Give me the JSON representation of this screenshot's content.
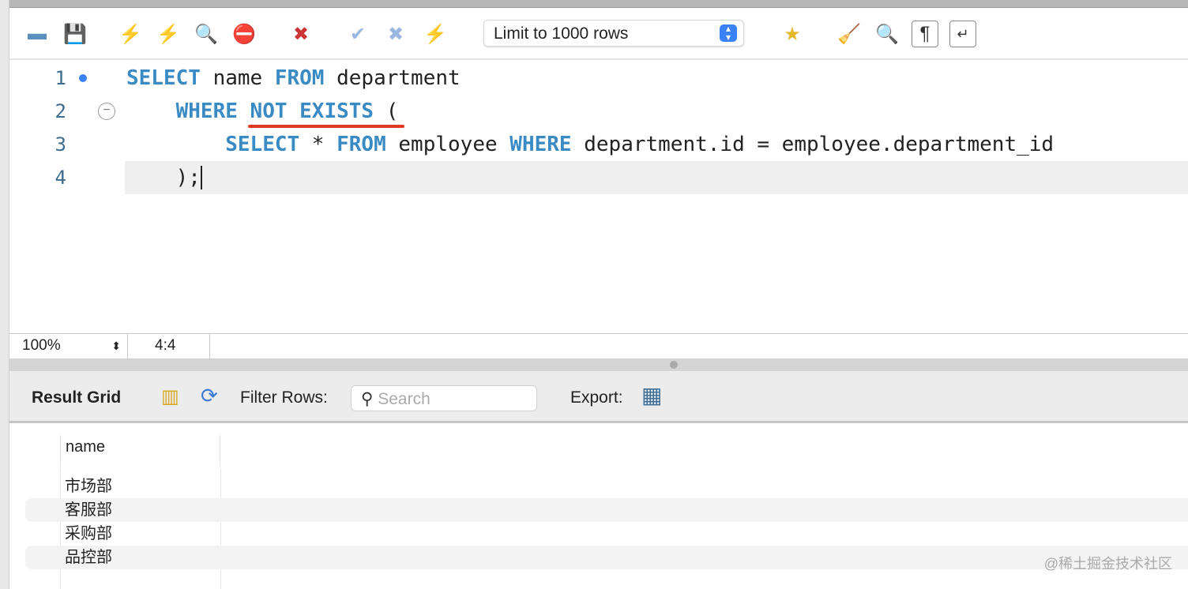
{
  "toolbar": {
    "limit_select": "Limit to 1000 rows"
  },
  "editor": {
    "lines": [
      {
        "num": "1",
        "parts": [
          {
            "t": "SELECT",
            "k": 1
          },
          {
            "t": " name ",
            "k": 0
          },
          {
            "t": "FROM",
            "k": 1
          },
          {
            "t": " department",
            "k": 0
          }
        ]
      },
      {
        "num": "2",
        "parts": [
          {
            "t": "    ",
            "k": 0
          },
          {
            "t": "WHERE NOT EXISTS",
            "k": 1
          },
          {
            "t": " (",
            "k": 0
          }
        ]
      },
      {
        "num": "3",
        "parts": [
          {
            "t": "        ",
            "k": 0
          },
          {
            "t": "SELECT",
            "k": 1
          },
          {
            "t": " * ",
            "k": 0
          },
          {
            "t": "FROM",
            "k": 1
          },
          {
            "t": " employee ",
            "k": 0
          },
          {
            "t": "WHERE",
            "k": 1
          },
          {
            "t": " department.id = employee.department_id",
            "k": 0
          }
        ]
      },
      {
        "num": "4",
        "parts": [
          {
            "t": "    );",
            "k": 0
          }
        ]
      }
    ]
  },
  "status": {
    "zoom": "100%",
    "cursor": "4:4"
  },
  "results": {
    "title": "Result Grid",
    "filter_label": "Filter Rows:",
    "search_placeholder": "Search",
    "export_label": "Export:",
    "column": "name",
    "rows": [
      "市场部",
      "客服部",
      "采购部",
      "品控部"
    ]
  },
  "watermark": "@稀土掘金技术社区"
}
